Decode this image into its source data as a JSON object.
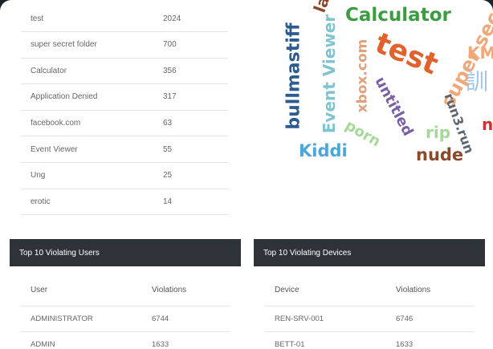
{
  "top_list": [
    {
      "name": "test",
      "count": "2024"
    },
    {
      "name": "super secret folder",
      "count": "700"
    },
    {
      "name": "Calculator",
      "count": "356"
    },
    {
      "name": "Application Denied",
      "count": "317"
    },
    {
      "name": "facebook.com",
      "count": "63"
    },
    {
      "name": "Event Viewer",
      "count": "55"
    },
    {
      "name": "Ung",
      "count": "25"
    },
    {
      "name": "erotic",
      "count": "14"
    }
  ],
  "word_cloud": {
    "words": [
      {
        "text": "Calculator",
        "color": "#3c9c41"
      },
      {
        "text": "test",
        "color": "#e0622d"
      },
      {
        "text": "super secre",
        "color": "#f0a878"
      },
      {
        "text": "KMA",
        "color": "#f0a878"
      },
      {
        "text": "bullmastiff",
        "color": "#2c5b8f"
      },
      {
        "text": "Event Viewer",
        "color": "#7fc4cf"
      },
      {
        "text": "xbox.com",
        "color": "#e0a07a"
      },
      {
        "text": "untitled",
        "color": "#7a5ea6"
      },
      {
        "text": "run3.run",
        "color": "#5c6670"
      },
      {
        "text": "porn",
        "color": "#a6d89a"
      },
      {
        "text": "rip",
        "color": "#a6d89a"
      },
      {
        "text": "nude",
        "color": "#8a4a2a"
      },
      {
        "text": "Kiddi",
        "color": "#4ca6d8"
      },
      {
        "text": "訓",
        "color": "#a0c4e6"
      },
      {
        "text": "lal",
        "color": "#8a4a2a"
      },
      {
        "text": "n",
        "color": "#d03030"
      }
    ]
  },
  "users_section": {
    "title": "Top 10 Violating Users",
    "col_1": "User",
    "col_2": "Violations",
    "rows": [
      {
        "name": "ADMINISTRATOR",
        "count": "6744"
      },
      {
        "name": "ADMIN",
        "count": "1633"
      }
    ]
  },
  "devices_section": {
    "title": "Top 10 Violating Devices",
    "col_1": "Device",
    "col_2": "Violations",
    "rows": [
      {
        "name": "REN-SRV-001",
        "count": "6746"
      },
      {
        "name": "BETT-01",
        "count": "1633"
      }
    ]
  }
}
